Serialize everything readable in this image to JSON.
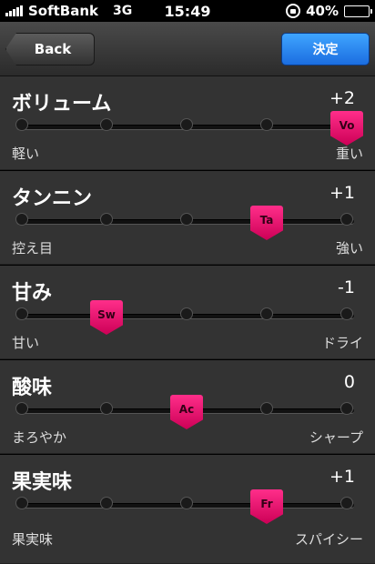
{
  "status": {
    "carrier": "SoftBank",
    "network": "3G",
    "time": "15:49",
    "battery": "40%",
    "battery_level": 0.4
  },
  "nav": {
    "back": "Back",
    "confirm": "決定"
  },
  "sections": [
    {
      "title": "ボリューム",
      "value": "+2",
      "thumb": "Vo",
      "min": "軽い",
      "max": "重い",
      "level": 2
    },
    {
      "title": "タンニン",
      "value": "+1",
      "thumb": "Ta",
      "min": "控え目",
      "max": "強い",
      "level": 1
    },
    {
      "title": "甘み",
      "value": "-1",
      "thumb": "Sw",
      "min": "甘い",
      "max": "ドライ",
      "level": -1
    },
    {
      "title": "酸味",
      "value": "0",
      "thumb": "Ac",
      "min": "まろやか",
      "max": "シャープ",
      "level": 0
    },
    {
      "title": "果実味",
      "value": "+1",
      "thumb": "Fr",
      "min": "果実味",
      "max": "スパイシー",
      "level": 1
    }
  ]
}
